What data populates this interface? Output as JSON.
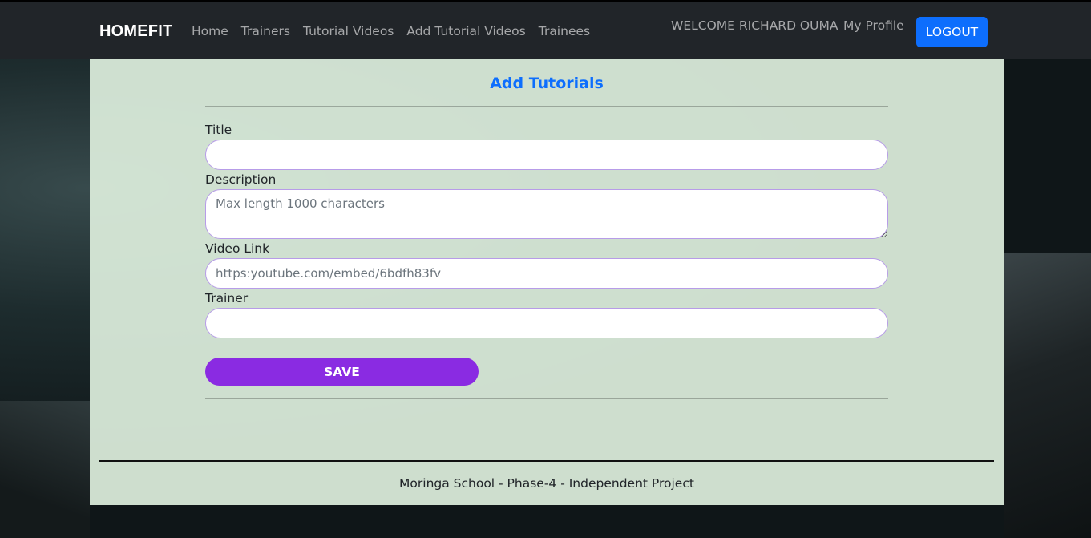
{
  "navbar": {
    "brand": "HOMEFIT",
    "links": [
      {
        "label": "Home"
      },
      {
        "label": "Trainers"
      },
      {
        "label": "Tutorial Videos"
      },
      {
        "label": "Add Tutorial Videos"
      },
      {
        "label": "Trainees"
      }
    ],
    "welcome": "WELCOME RICHARD OUMA",
    "profile": "My Profile",
    "logout": "LOGOUT"
  },
  "form": {
    "title": "Add Tutorials",
    "title_label": "Title",
    "title_value": "",
    "description_label": "Description",
    "description_placeholder": "Max length 1000 characters",
    "video_link_label": "Video Link",
    "video_link_placeholder": "https:youtube.com/embed/6bdfh83fv",
    "trainer_label": "Trainer",
    "trainer_value": "",
    "save_label": "SAVE"
  },
  "footer": {
    "text": "Moringa School - Phase-4 - Independent Project"
  },
  "colors": {
    "navbar_bg": "#212529",
    "primary": "#0d6efd",
    "save_button": "#8a2be2",
    "panel_bg": "#ddeedd",
    "input_border": "#b79ce8"
  }
}
